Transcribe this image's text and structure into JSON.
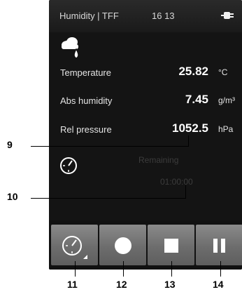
{
  "status": {
    "title": "Humidity | TFF",
    "time": "16 13"
  },
  "icons": {
    "weather": "cloud-rain-icon",
    "battery": "power-plug-icon",
    "timer": "stopwatch-icon"
  },
  "readings": [
    {
      "label": "Temperature",
      "value": "25.82",
      "unit": "°C"
    },
    {
      "label": "Abs humidity",
      "value": "7.45",
      "unit": "g/m³"
    },
    {
      "label": "Rel pressure",
      "value": "1052.5",
      "unit": "hPa"
    }
  ],
  "timer": {
    "label": "Remaining",
    "value": "01:00:00"
  },
  "toolbar": {
    "buttons": [
      "timer-settings-button",
      "record-button",
      "stop-button",
      "pause-button"
    ]
  },
  "callouts": [
    "9",
    "10",
    "11",
    "12",
    "13",
    "14"
  ],
  "colors": {
    "screen": "#141414",
    "button": "#777777",
    "text": "#ffffff"
  }
}
